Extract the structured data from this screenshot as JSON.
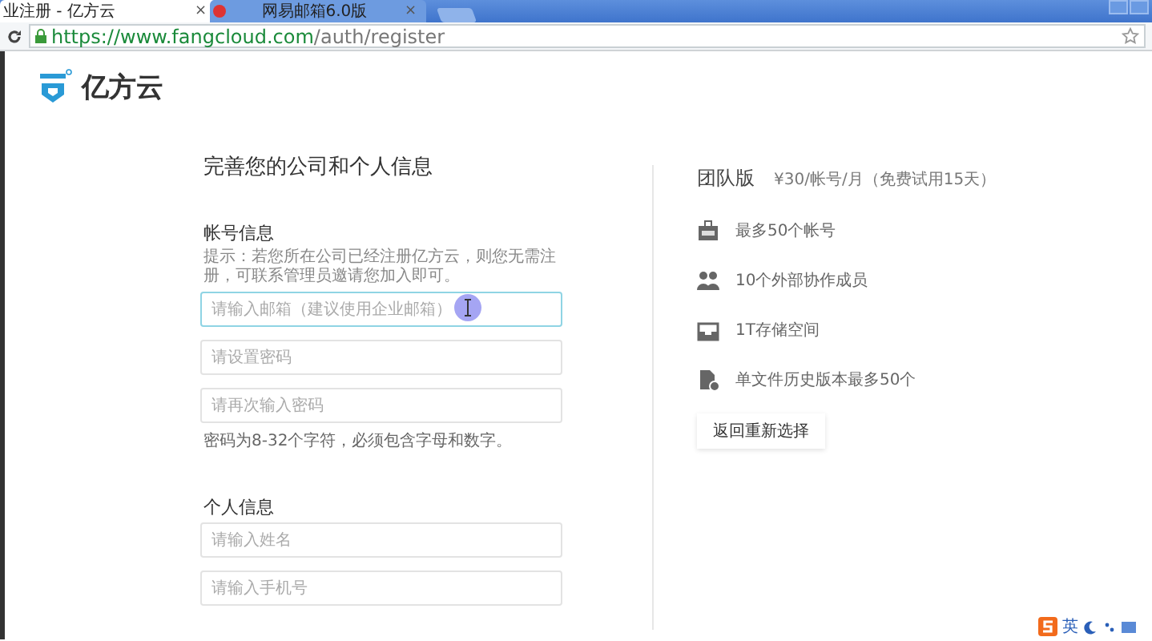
{
  "browser": {
    "tabs": [
      {
        "title": "业注册 - 亿方云",
        "close": "×",
        "selected": true
      },
      {
        "title": "网易邮箱6.0版",
        "close": "×",
        "selected": false
      }
    ],
    "url": {
      "host": "https://www.fangcloud.com",
      "path": "/auth/register"
    }
  },
  "logo": {
    "name": "亿方云"
  },
  "form": {
    "title": "完善您的公司和个人信息",
    "sections": [
      {
        "heading": "帐号信息",
        "hint": "提示：若您所在公司已经注册亿方云，则您无需注册，可联系管理员邀请您加入即可。",
        "fields": [
          {
            "placeholder": "请输入邮箱（建议使用企业邮箱）",
            "focused": true
          },
          {
            "placeholder": "请设置密码",
            "focused": false
          },
          {
            "placeholder": "请再次输入密码",
            "focused": false
          }
        ],
        "note": "密码为8-32个字符，必须包含字母和数字。"
      },
      {
        "heading": "个人信息",
        "fields": [
          {
            "placeholder": "请输入姓名",
            "focused": false
          },
          {
            "placeholder": "请输入手机号",
            "focused": false
          }
        ]
      }
    ]
  },
  "plan": {
    "name": "团队版",
    "price": "¥30/帐号/月（免费试用15天）",
    "features": [
      {
        "kind": "badge",
        "text": "最多50个帐号"
      },
      {
        "kind": "people",
        "text": "10个外部协作成员"
      },
      {
        "kind": "tray",
        "text": "1T存储空间"
      },
      {
        "kind": "file",
        "text": "单文件历史版本最多50个"
      }
    ],
    "button": "返回重新选择"
  },
  "ime": {
    "label": "英"
  }
}
